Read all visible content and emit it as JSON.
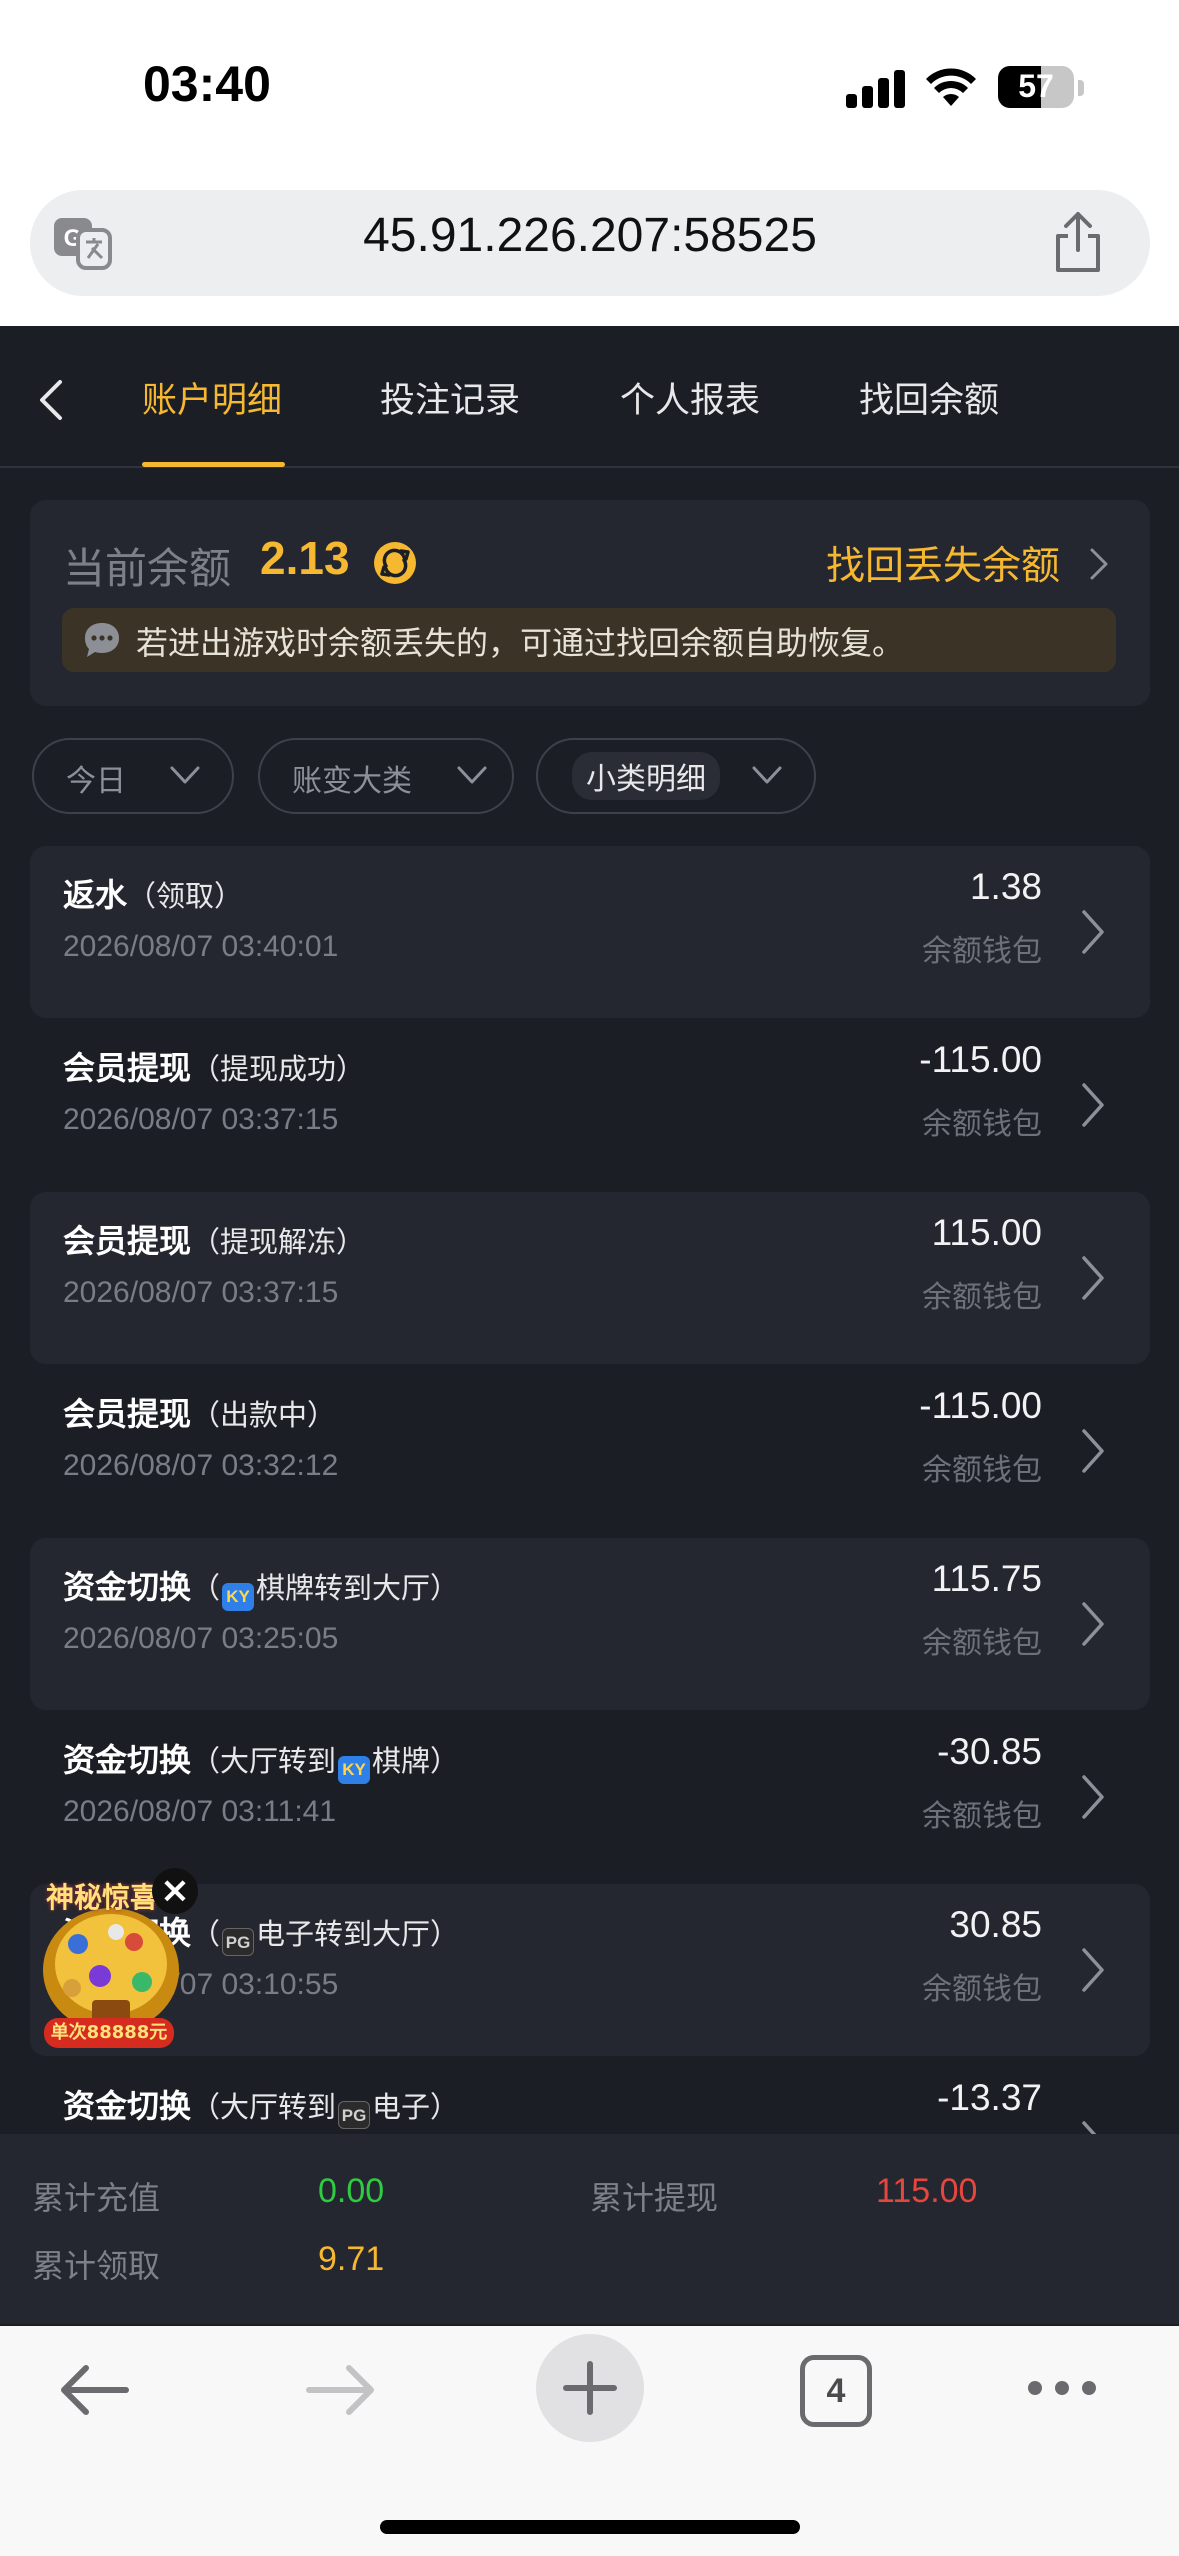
{
  "status_bar": {
    "time": "03:40",
    "battery": "57",
    "battery_level": 0.57
  },
  "browser": {
    "url": "45.91.226.207:58525",
    "tab_count": "4"
  },
  "nav": {
    "tabs": [
      {
        "label": "账户明细",
        "active": true
      },
      {
        "label": "投注记录",
        "active": false
      },
      {
        "label": "个人报表",
        "active": false
      },
      {
        "label": "找回余额",
        "active": false
      }
    ]
  },
  "balance": {
    "label": "当前余额",
    "value": "2.13",
    "recover_label": "找回丢失余额",
    "notice": "若进出游戏时余额丢失的，可通过找回余额自助恢复。"
  },
  "filters": [
    {
      "label": "今日"
    },
    {
      "label": "账变大类"
    },
    {
      "label": "小类明细"
    }
  ],
  "records": [
    {
      "title": "返水",
      "sub_pre": "（领取）",
      "badge": "",
      "sub_post": "",
      "date": "2026/08/07 03:40:01",
      "amount": "1.38",
      "wallet": "余额钱包"
    },
    {
      "title": "会员提现",
      "sub_pre": "（提现成功）",
      "badge": "",
      "sub_post": "",
      "date": "2026/08/07 03:37:15",
      "amount": "-115.00",
      "wallet": "余额钱包"
    },
    {
      "title": "会员提现",
      "sub_pre": "（提现解冻）",
      "badge": "",
      "sub_post": "",
      "date": "2026/08/07 03:37:15",
      "amount": "115.00",
      "wallet": "余额钱包"
    },
    {
      "title": "会员提现",
      "sub_pre": "（出款中）",
      "badge": "",
      "sub_post": "",
      "date": "2026/08/07 03:32:12",
      "amount": "-115.00",
      "wallet": "余额钱包"
    },
    {
      "title": "资金切换",
      "sub_pre": "（",
      "badge": "KY",
      "sub_post": "棋牌转到大厅）",
      "date": "2026/08/07 03:25:05",
      "amount": "115.75",
      "wallet": "余额钱包"
    },
    {
      "title": "资金切换",
      "sub_pre": "（大厅转到",
      "badge": "KY",
      "sub_post": "棋牌）",
      "date": "2026/08/07 03:11:41",
      "amount": "-30.85",
      "wallet": "余额钱包"
    },
    {
      "title": "资金切换",
      "sub_pre": "（",
      "badge": "PG",
      "sub_post": "电子转到大厅）",
      "date": "2026/08/07 03:10:55",
      "amount": "30.85",
      "wallet": "余额钱包"
    },
    {
      "title": "资金切换",
      "sub_pre": "（大厅转到",
      "badge": "PG",
      "sub_post": "电子）",
      "date": "",
      "amount": "-13.37",
      "wallet": ""
    }
  ],
  "summary": {
    "recharge_label": "累计充值",
    "recharge_value": "0.00",
    "withdraw_label": "累计提现",
    "withdraw_value": "115.00",
    "claim_label": "累计领取",
    "claim_value": "9.71"
  },
  "promo": {
    "title": "神秘惊喜",
    "footer": "单次88888元"
  },
  "colors": {
    "accent": "#f5b830",
    "bg": "#1b1e25",
    "card": "#24272f",
    "green": "#2ecc40",
    "red": "#e5473f"
  }
}
